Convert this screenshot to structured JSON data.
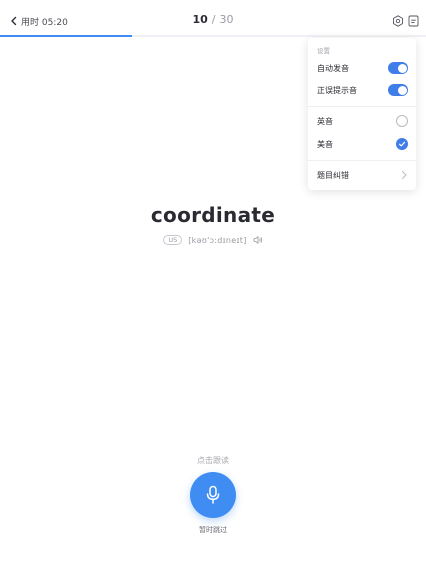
{
  "header": {
    "timer_text": "用时 05:20",
    "progress_current": "10",
    "progress_separator": "/",
    "progress_total": "30",
    "progress_fraction": 0.31
  },
  "word": {
    "text": "coordinate",
    "accent_badge": "US",
    "phonetic": "[kəʊ'ɔːdɪneɪt]"
  },
  "bottom": {
    "hint": "点击跟读",
    "skip_label": "暂时跳过"
  },
  "settings_panel": {
    "title": "设置",
    "auto_play_label": "自动发音",
    "auto_play_on": true,
    "correct_sound_label": "正误提示音",
    "correct_sound_on": true,
    "british_label": "英音",
    "american_label": "美音",
    "selected_accent": "美音",
    "report_error_label": "题目纠错"
  },
  "colors": {
    "accent": "#3f8cf2",
    "toggle_on": "#3f7ee8",
    "text_primary": "#2b2b33",
    "text_muted": "#9a9aa2"
  },
  "icons": {
    "back": "chevron-left-icon",
    "settings": "settings-icon",
    "note": "note-icon",
    "speaker": "speaker-icon",
    "mic": "microphone-icon",
    "check": "check-icon",
    "chevron_right": "chevron-right-icon"
  }
}
